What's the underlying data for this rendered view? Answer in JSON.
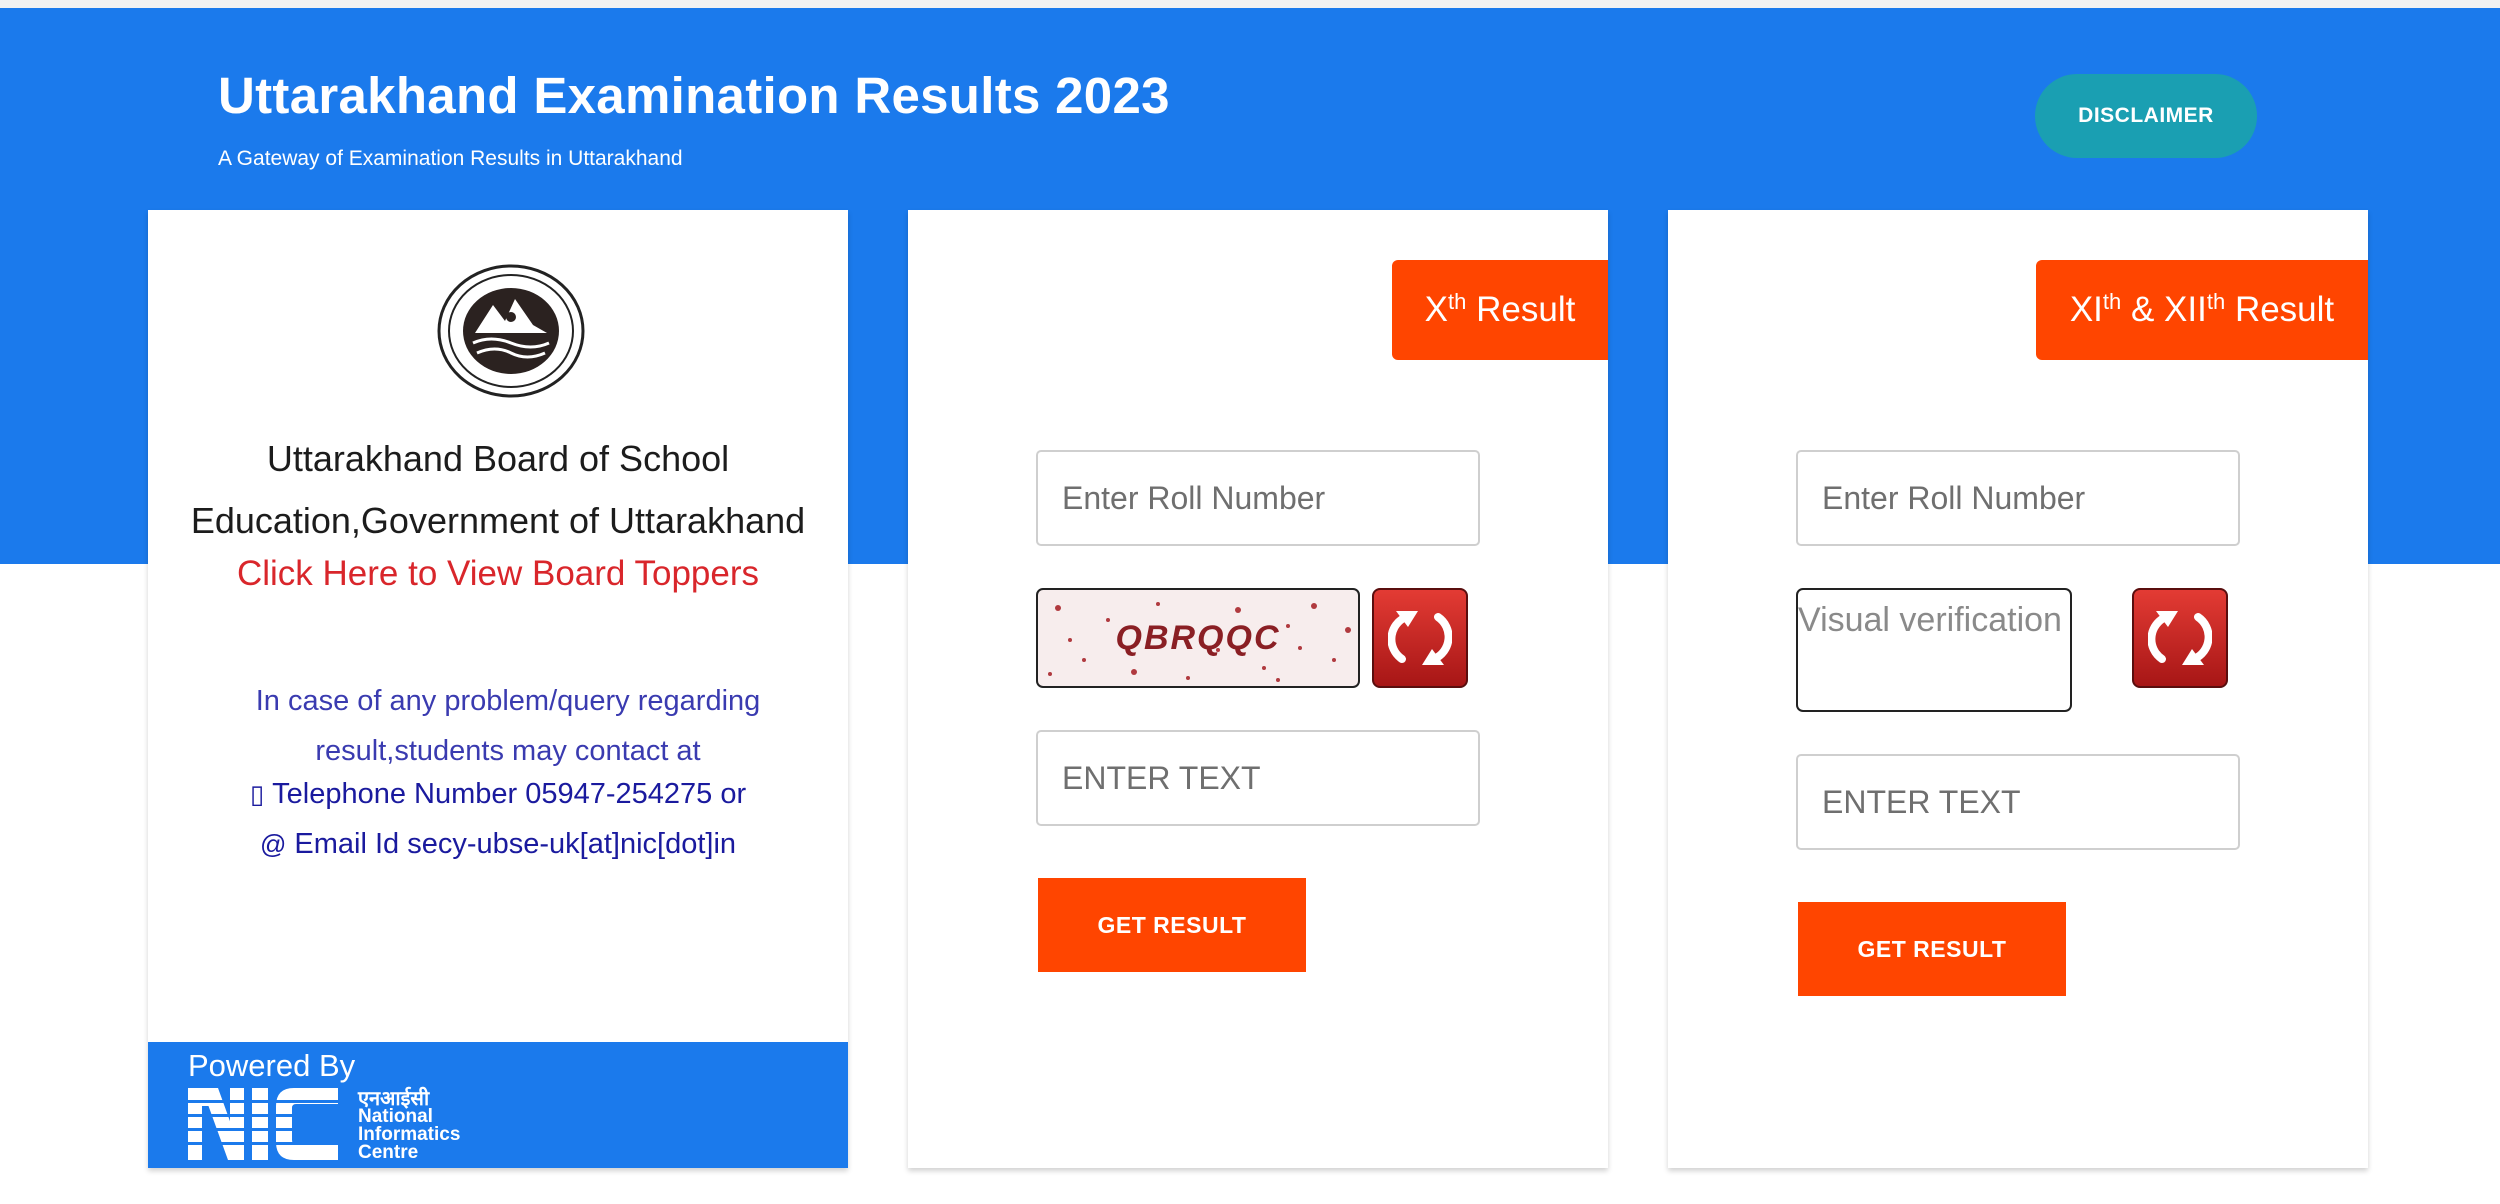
{
  "header": {
    "title": "Uttarakhand Examination Results 2023",
    "subtitle": "A Gateway of Examination Results in Uttarakhand",
    "disclaimer_label": "DISCLAIMER"
  },
  "board_card": {
    "emblem_icon": "ubse-emblem-icon",
    "board_name": "Uttarakhand Board of School Education,Government of Uttarakhand",
    "toppers_link": "Click Here to View Board Toppers",
    "help_text": "In case of any problem/query regarding result,students may contact at",
    "phone_text": "Telephone Number 05947-254275 or",
    "phone_icon": "mobile-phone-icon",
    "email_text": "Email Id secy-ubse-uk[at]nic[dot]in",
    "email_icon": "at-sign-icon",
    "powered_by": "Powered By",
    "nic_hindi": "एनआईसी",
    "nic_name_lines": [
      "National",
      "Informatics",
      "Centre"
    ]
  },
  "class10_card": {
    "tab_prefix": "X",
    "tab_sup": "th",
    "tab_suffix": " Result",
    "roll_placeholder": "Enter Roll Number",
    "captcha_text": "QBRQQC",
    "refresh_icon": "refresh-icon",
    "text_placeholder": "ENTER TEXT",
    "button_label": "GET RESULT"
  },
  "class12_card": {
    "tab_prefix_1": "XI",
    "tab_sup_1": "th",
    "tab_mid": " & XII",
    "tab_sup_2": "th",
    "tab_suffix": " Result",
    "roll_placeholder": "Enter Roll Number",
    "captcha_alt": "Visual verification",
    "refresh_icon": "refresh-icon",
    "text_placeholder": "ENTER TEXT",
    "button_label": "GET RESULT"
  },
  "colors": {
    "header_blue": "#1b7aec",
    "accent_orange": "#ff4500",
    "disclaimer_teal": "#1a9fb2",
    "link_red": "#d9262b",
    "contact_blue": "#1a1a9e"
  }
}
